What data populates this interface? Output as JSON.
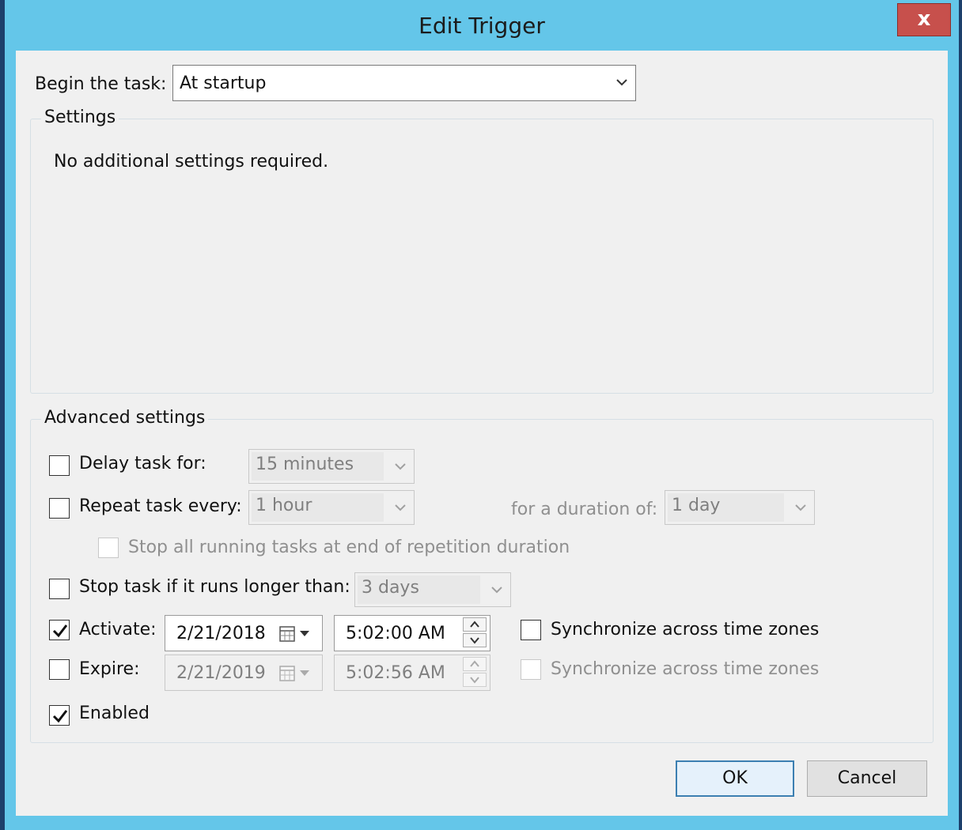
{
  "window": {
    "title": "Edit Trigger",
    "close_label": "x"
  },
  "begin": {
    "label": "Begin the task:",
    "value": "At startup"
  },
  "settings": {
    "title": "Settings",
    "message": "No additional settings required."
  },
  "advanced": {
    "title": "Advanced settings",
    "delay": {
      "label": "Delay task for:",
      "value": "15 minutes",
      "checked": false
    },
    "repeat": {
      "label": "Repeat task every:",
      "value": "1 hour",
      "checked": false,
      "duration_label": "for a duration of:",
      "duration_value": "1 day"
    },
    "stop_all": {
      "label": "Stop all running tasks at end of repetition duration",
      "checked": false
    },
    "stop_longer": {
      "label": "Stop task if it runs longer than:",
      "value": "3 days",
      "checked": false
    },
    "activate": {
      "label": "Activate:",
      "date": "2/21/2018",
      "time": "5:02:00 AM",
      "checked": true,
      "sync_label": "Synchronize across time zones"
    },
    "expire": {
      "label": "Expire:",
      "date": "2/21/2019",
      "time": "5:02:56 AM",
      "checked": false,
      "sync_label": "Synchronize across time zones"
    },
    "enabled": {
      "label": "Enabled",
      "checked": true
    }
  },
  "buttons": {
    "ok": "OK",
    "cancel": "Cancel"
  }
}
